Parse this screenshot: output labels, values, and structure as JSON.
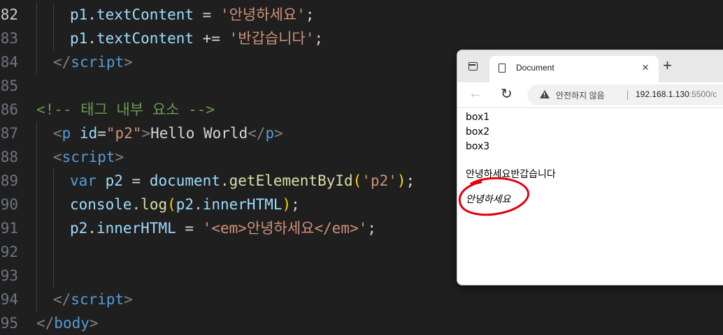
{
  "editor": {
    "lines": [
      {
        "num": "82",
        "segments": [
          {
            "c": "id",
            "t": "p1"
          },
          {
            "c": "op",
            "t": "."
          },
          {
            "c": "id",
            "t": "textContent"
          },
          {
            "c": "op",
            "t": " = "
          },
          {
            "c": "str",
            "t": "'안녕하세요'"
          },
          {
            "c": "op",
            "t": ";"
          }
        ]
      },
      {
        "num": "83",
        "segments": [
          {
            "c": "id",
            "t": "p1"
          },
          {
            "c": "op",
            "t": "."
          },
          {
            "c": "id",
            "t": "textContent"
          },
          {
            "c": "op",
            "t": " += "
          },
          {
            "c": "str",
            "t": "'반갑습니다'"
          },
          {
            "c": "op",
            "t": ";"
          }
        ]
      },
      {
        "num": "84",
        "segments": [
          {
            "c": "br",
            "t": "</"
          },
          {
            "c": "tag",
            "t": "script"
          },
          {
            "c": "br",
            "t": ">"
          }
        ]
      },
      {
        "num": "85",
        "segments": []
      },
      {
        "num": "86",
        "segments": [
          {
            "c": "cm",
            "t": "<!-- 태그 내부 요소 -->"
          }
        ]
      },
      {
        "num": "87",
        "segments": [
          {
            "c": "br",
            "t": "<"
          },
          {
            "c": "tag",
            "t": "p"
          },
          {
            "c": "attr",
            "t": " id"
          },
          {
            "c": "op",
            "t": "="
          },
          {
            "c": "str",
            "t": "\"p2\""
          },
          {
            "c": "br",
            "t": ">"
          },
          {
            "c": "txt",
            "t": "Hello World"
          },
          {
            "c": "br",
            "t": "</"
          },
          {
            "c": "tag",
            "t": "p"
          },
          {
            "c": "br",
            "t": ">"
          }
        ]
      },
      {
        "num": "88",
        "segments": [
          {
            "c": "br",
            "t": "<"
          },
          {
            "c": "tag",
            "t": "script"
          },
          {
            "c": "br",
            "t": ">"
          }
        ]
      },
      {
        "num": "89",
        "segments": [
          {
            "c": "kw",
            "t": "var"
          },
          {
            "c": "op",
            "t": " "
          },
          {
            "c": "id",
            "t": "p2"
          },
          {
            "c": "op",
            "t": " = "
          },
          {
            "c": "id",
            "t": "document"
          },
          {
            "c": "op",
            "t": "."
          },
          {
            "c": "fn",
            "t": "getElementById"
          },
          {
            "c": "paren",
            "t": "("
          },
          {
            "c": "str",
            "t": "'p2'"
          },
          {
            "c": "paren",
            "t": ")"
          },
          {
            "c": "op",
            "t": ";"
          }
        ]
      },
      {
        "num": "90",
        "segments": [
          {
            "c": "id",
            "t": "console"
          },
          {
            "c": "op",
            "t": "."
          },
          {
            "c": "fn",
            "t": "log"
          },
          {
            "c": "paren",
            "t": "("
          },
          {
            "c": "id",
            "t": "p2"
          },
          {
            "c": "op",
            "t": "."
          },
          {
            "c": "id",
            "t": "innerHTML"
          },
          {
            "c": "paren",
            "t": ")"
          },
          {
            "c": "op",
            "t": ";"
          }
        ]
      },
      {
        "num": "91",
        "segments": [
          {
            "c": "id",
            "t": "p2"
          },
          {
            "c": "op",
            "t": "."
          },
          {
            "c": "id",
            "t": "innerHTML"
          },
          {
            "c": "op",
            "t": " = "
          },
          {
            "c": "str",
            "t": "'<em>안녕하세요</em>'"
          },
          {
            "c": "op",
            "t": ";"
          }
        ]
      },
      {
        "num": "92",
        "segments": []
      },
      {
        "num": "93",
        "segments": []
      },
      {
        "num": "94",
        "segments": [
          {
            "c": "br",
            "t": "</"
          },
          {
            "c": "tag",
            "t": "script"
          },
          {
            "c": "br",
            "t": ">"
          }
        ]
      },
      {
        "num": "95",
        "segments": [
          {
            "c": "br",
            "t": "</"
          },
          {
            "c": "tag",
            "t": "body"
          },
          {
            "c": "br",
            "t": ">"
          }
        ]
      }
    ]
  },
  "browser": {
    "tab_title": "Document",
    "tab_close": "×",
    "new_tab": "+",
    "back": "←",
    "reload": "↻",
    "security_label": "안전하지 않음",
    "url": "192.168.1.130",
    "url_rest": ":5500/c",
    "page": {
      "box1": "box1",
      "box2": "box2",
      "box3": "box3",
      "p1": "안녕하세요반갑습니다",
      "p2": "안녕하세요"
    }
  },
  "colors": {
    "annotation": "#e3000f",
    "editor_bg": "#1f1f1f"
  }
}
